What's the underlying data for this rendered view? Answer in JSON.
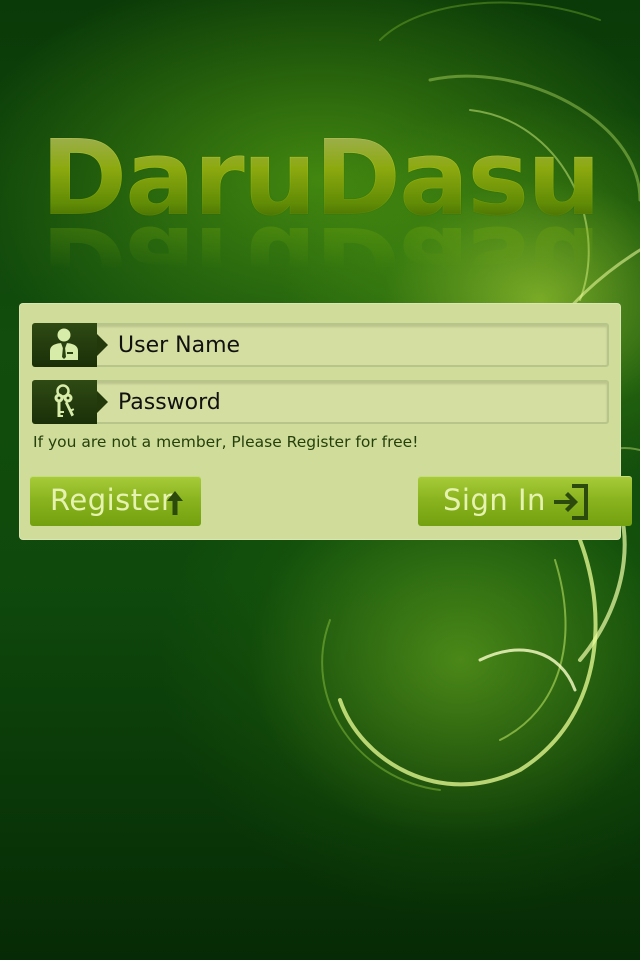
{
  "app": {
    "logo_text": "DaruDasu"
  },
  "login": {
    "username": {
      "placeholder": "User Name",
      "icon": "user-icon"
    },
    "password": {
      "placeholder": "Password",
      "icon": "keys-icon"
    },
    "register_hint": "If you are not a member, Please Register for free!",
    "register_button": {
      "label": "Register",
      "icon": "up-arrow-icon"
    },
    "signin_button": {
      "label": "Sign In",
      "icon": "sign-in-icon"
    }
  },
  "colors": {
    "background": "#124d0d",
    "panel": "#cfdc9a",
    "button": "#8bb520",
    "button_text": "#e6f3b0",
    "icon_box": "#23390c"
  }
}
